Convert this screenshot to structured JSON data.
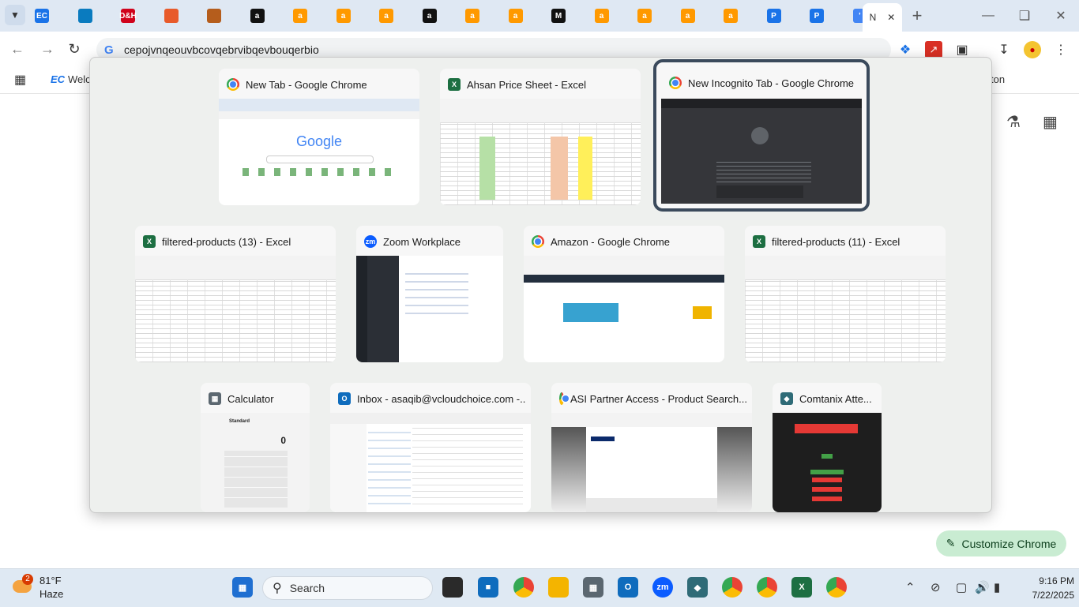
{
  "browser": {
    "tabs": [
      {
        "label": "EC",
        "color": "#1a73e8"
      },
      {
        "label": "",
        "color": "#0a7bbf"
      },
      {
        "label": "D&H",
        "color": "#d0021b"
      },
      {
        "label": "",
        "color": "#e85a2a"
      },
      {
        "label": "",
        "color": "#b55d1c"
      },
      {
        "label": "a",
        "color": "#111111"
      },
      {
        "label": "a",
        "color": "#ff9900"
      },
      {
        "label": "a",
        "color": "#ff9900"
      },
      {
        "label": "a",
        "color": "#ff9900"
      },
      {
        "label": "a",
        "color": "#111111"
      },
      {
        "label": "a",
        "color": "#ff9900"
      },
      {
        "label": "a",
        "color": "#ff9900"
      },
      {
        "label": "M",
        "color": "#111111"
      },
      {
        "label": "a",
        "color": "#ff9900"
      },
      {
        "label": "a",
        "color": "#ff9900"
      },
      {
        "label": "a",
        "color": "#ff9900"
      },
      {
        "label": "a",
        "color": "#ff9900"
      },
      {
        "label": "P",
        "color": "#1a73e8"
      },
      {
        "label": "P",
        "color": "#1a73e8"
      },
      {
        "label": "'",
        "color": "#4285f4"
      }
    ],
    "active_tab_label": "N",
    "url": "cepojvnqeouvbcovqebrvibqevbouqerbio",
    "bookmark_item": "Welc",
    "bookmark_right": "ton",
    "customize_label": "Customize Chrome"
  },
  "switcher": {
    "windows": [
      {
        "title": "New Tab - Google Chrome",
        "app": "chrome"
      },
      {
        "title": "Ahsan Price Sheet - Excel",
        "app": "excel"
      },
      {
        "title": "New Incognito Tab - Google Chrome",
        "app": "chrome",
        "selected": true
      },
      {
        "title": "filtered-products (13) - Excel",
        "app": "excel"
      },
      {
        "title": "Zoom Workplace",
        "app": "zoom"
      },
      {
        "title": "Amazon - Google Chrome",
        "app": "chrome"
      },
      {
        "title": "filtered-products (11) - Excel",
        "app": "excel"
      },
      {
        "title": "Calculator",
        "app": "calculator"
      },
      {
        "title": "Inbox - asaqib@vcloudchoice.com -...",
        "app": "outlook"
      },
      {
        "title": "ASI Partner Access - Product Search...",
        "app": "chrome"
      },
      {
        "title": "Comtanix Atte...",
        "app": "chrome"
      }
    ],
    "google_logo": "Google",
    "calc_mode": "Standard",
    "calc_value": "0"
  },
  "taskbar": {
    "weather_temp": "81°F",
    "weather_cond": "Haze",
    "weather_badge": "2",
    "search_placeholder": "Search",
    "time": "9:16 PM",
    "date": "7/22/2025"
  },
  "colors": {
    "excel_green": "#1d6f42",
    "zoom_blue": "#0b5cff",
    "outlook_blue": "#0f6cbd",
    "selected_outline": "#3b4a5c"
  }
}
